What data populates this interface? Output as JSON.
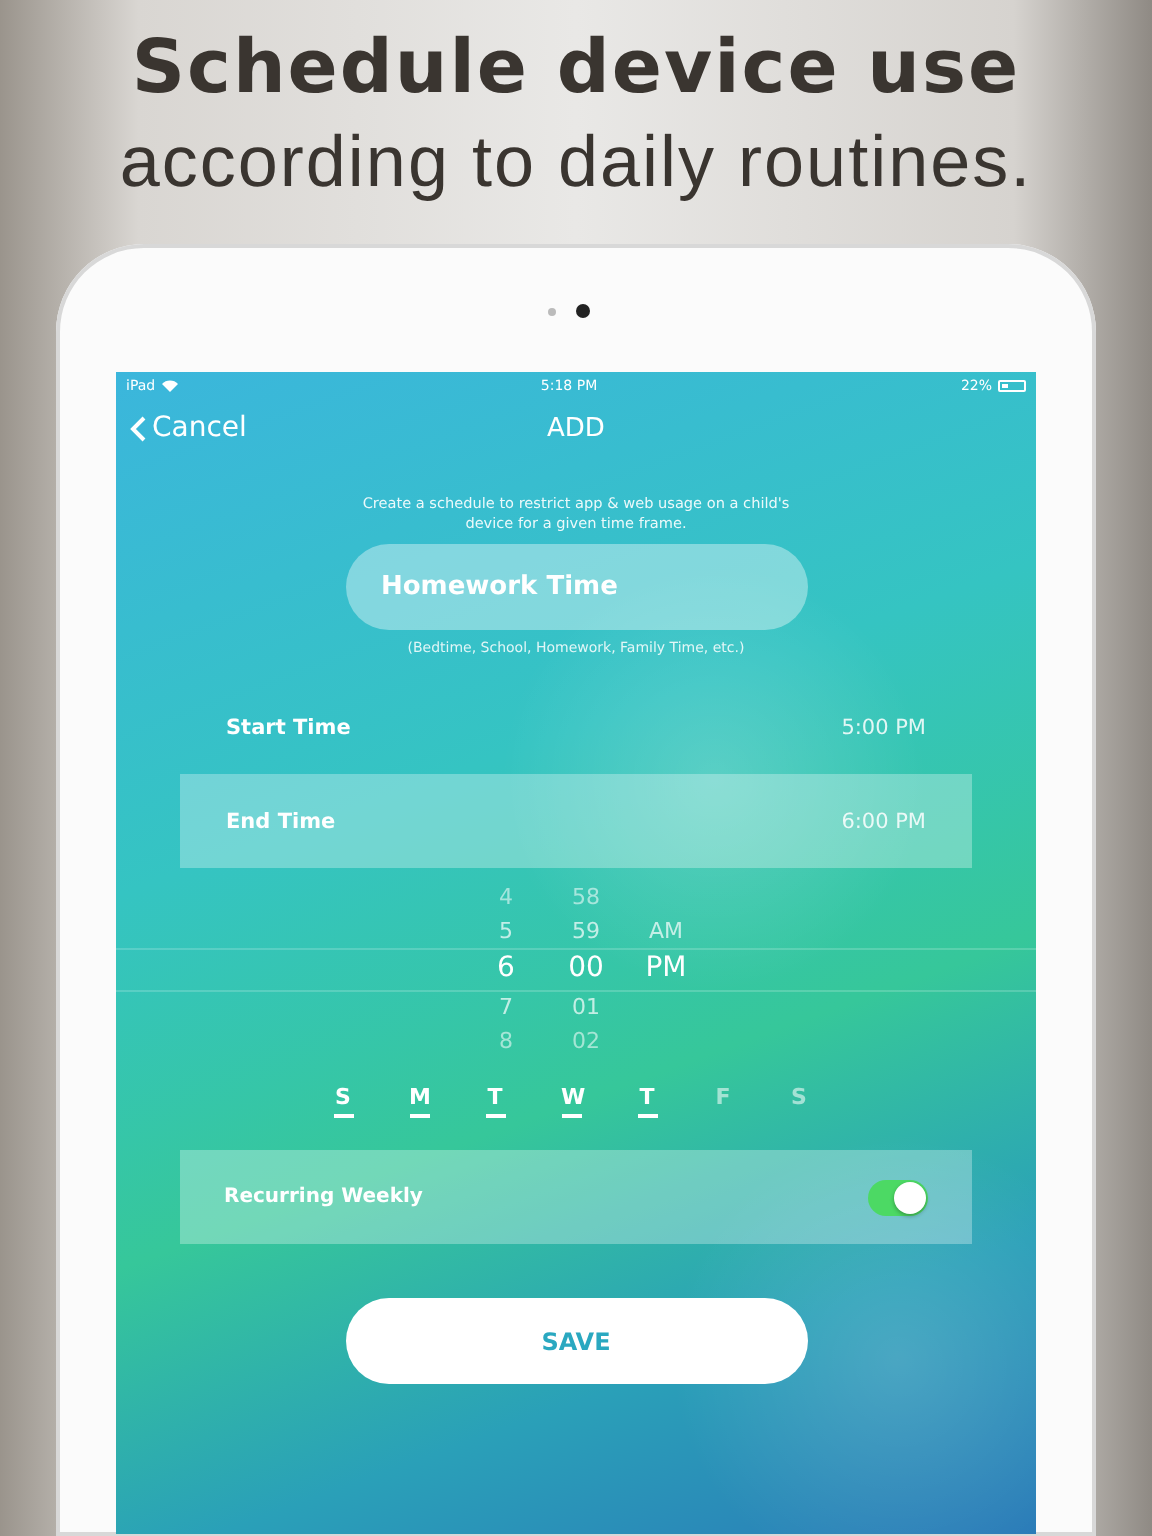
{
  "headline": {
    "title": "Schedule device use",
    "subtitle": "according to daily routines."
  },
  "status_bar": {
    "device": "iPad",
    "time": "5:18 PM",
    "battery": "22%"
  },
  "nav": {
    "back": "Cancel",
    "title": "ADD"
  },
  "description": "Create a schedule to restrict app & web usage on a child's device for a given time frame.",
  "name_field": {
    "value": "Homework Time",
    "hint": "(Bedtime, School, Homework, Family Time, etc.)"
  },
  "times": [
    {
      "label": "Start Time",
      "value": "5:00 PM",
      "selected": false
    },
    {
      "label": "End Time",
      "value": "6:00 PM",
      "selected": true
    }
  ],
  "picker": {
    "columns": [
      {
        "items": [
          {
            "text": "4",
            "selected": false
          },
          {
            "text": "5",
            "selected": false
          },
          {
            "text": "6",
            "selected": true
          },
          {
            "text": "7",
            "selected": false
          },
          {
            "text": "8",
            "selected": false
          }
        ]
      },
      {
        "items": [
          {
            "text": "58",
            "selected": false
          },
          {
            "text": "59",
            "selected": false
          },
          {
            "text": "00",
            "selected": true
          },
          {
            "text": "01",
            "selected": false
          },
          {
            "text": "02",
            "selected": false
          }
        ]
      },
      {
        "items": [
          {
            "text": "AM",
            "selected": false
          },
          {
            "text": "PM",
            "selected": true
          }
        ]
      }
    ]
  },
  "days": [
    {
      "label": "S",
      "selected": true
    },
    {
      "label": "M",
      "selected": true
    },
    {
      "label": "T",
      "selected": true
    },
    {
      "label": "W",
      "selected": true
    },
    {
      "label": "T",
      "selected": true
    },
    {
      "label": "F",
      "selected": false
    },
    {
      "label": "S",
      "selected": false
    }
  ],
  "recurring": {
    "label": "Recurring Weekly",
    "on": true
  },
  "save": "SAVE"
}
